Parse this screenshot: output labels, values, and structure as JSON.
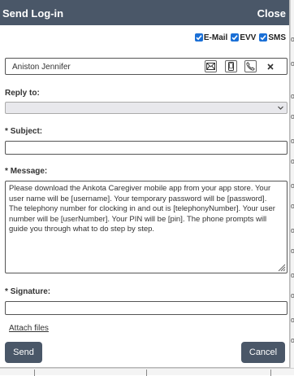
{
  "dialog": {
    "title": "Send Log-in",
    "close_label": "Close"
  },
  "channels": [
    {
      "label": "E-Mail",
      "checked": true
    },
    {
      "label": "EVV",
      "checked": true
    },
    {
      "label": "SMS",
      "checked": true
    }
  ],
  "recipient": {
    "name": "Aniston Jennifer",
    "icons": [
      "mail-icon",
      "mobile-phone-icon",
      "phone-icon",
      "remove-icon"
    ]
  },
  "reply_to": {
    "label": "Reply to:",
    "value": ""
  },
  "subject": {
    "label": "Subject:",
    "required_mark": "*",
    "value": ""
  },
  "message": {
    "label": "Message:",
    "required_mark": "*",
    "paragraphs": [
      "Please download the Ankota Caregiver mobile app from your app store. Your user name will be [username]. Your temporary password will be [password].",
      "The telephony number for clocking in and out is [telephonyNumber]. Your user number will be [userNumber]. Your PIN will be [pin]. The phone prompts will guide you through what to do step by step."
    ]
  },
  "signature": {
    "label": "Signature:",
    "required_mark": "*",
    "value": ""
  },
  "attach_label": "Attach files",
  "send_label": "Send",
  "cancel_label": "Cancel",
  "colors": {
    "titlebar": "#4a5768",
    "button": "#4a5768",
    "checkbox": "#1a6fd6"
  }
}
